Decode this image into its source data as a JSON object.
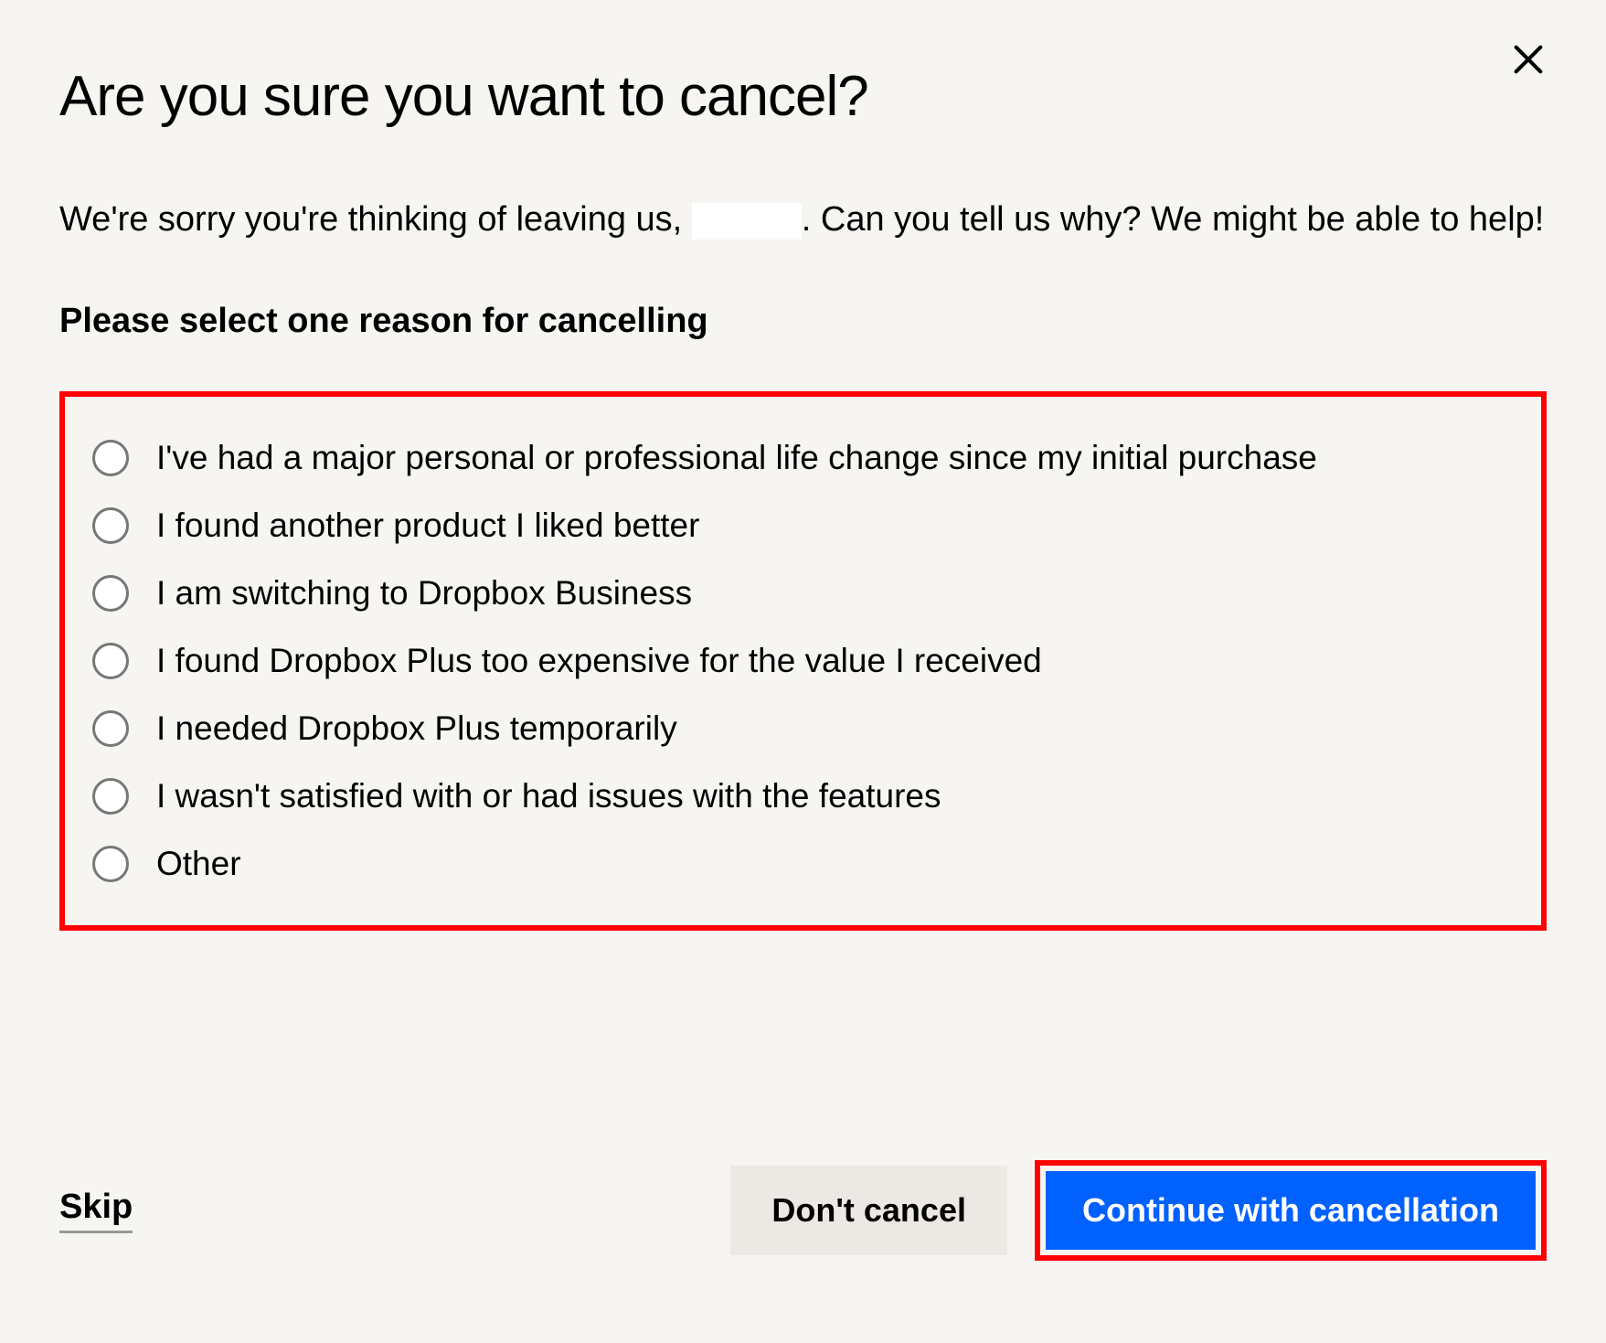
{
  "dialog": {
    "title": "Are you sure you want to cancel?",
    "subtitle_prefix": "We're sorry you're thinking of leaving us, ",
    "subtitle_suffix": ". Can you tell us why? We might be able to help!",
    "instruction": "Please select one reason for cancelling",
    "options": [
      "I've had a major personal or professional life change since my initial purchase",
      "I found another product I liked better",
      "I am switching to Dropbox Business",
      "I found Dropbox Plus too expensive for the value I received",
      "I needed Dropbox Plus temporarily",
      "I wasn't satisfied with or had issues with the features",
      "Other"
    ],
    "skip_label": "Skip",
    "dont_cancel_label": "Don't cancel",
    "continue_label": "Continue with cancellation"
  }
}
